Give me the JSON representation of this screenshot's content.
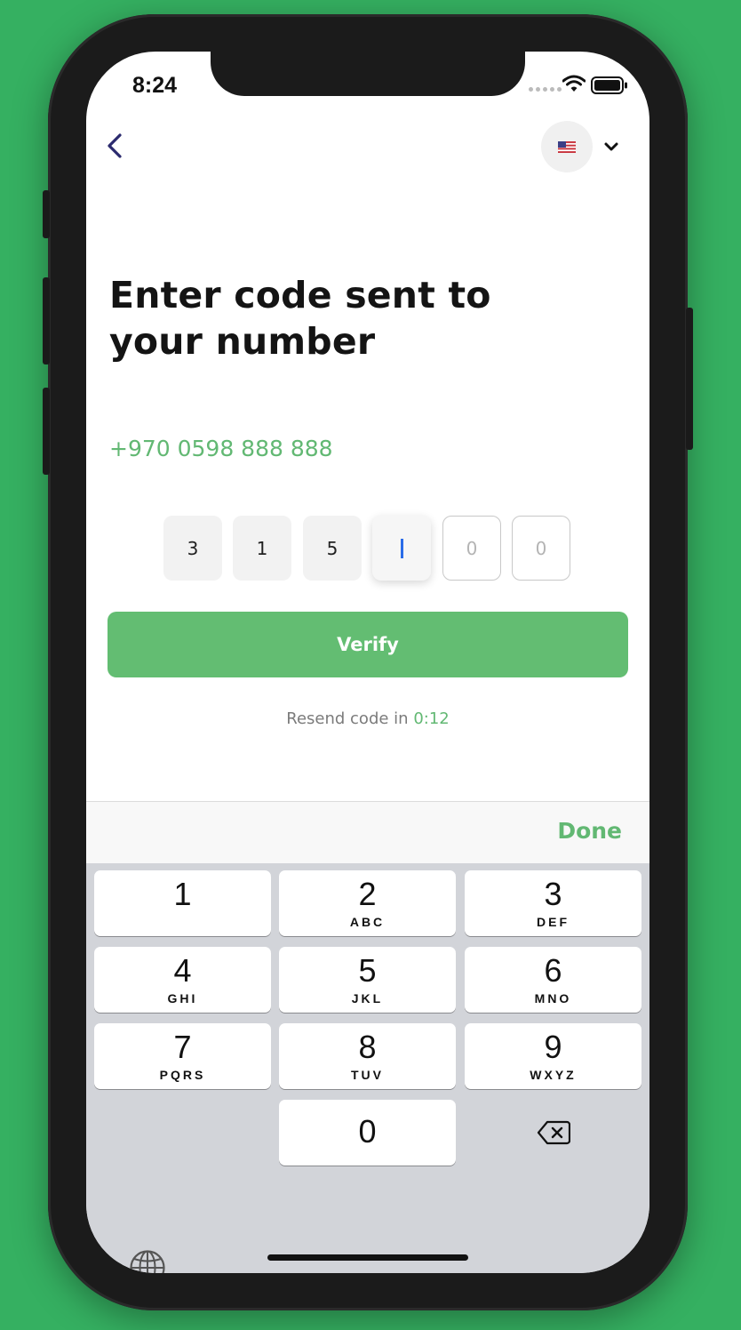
{
  "status_bar": {
    "time": "8:24"
  },
  "header": {
    "country": "US",
    "flag_icon": "us-flag-icon"
  },
  "title": "Enter code sent to your number",
  "phone_number": "+970 0598 888 888",
  "code": {
    "digits": [
      "3",
      "1",
      "5",
      "",
      "0",
      "0"
    ],
    "active_index": 3
  },
  "verify_label": "Verify",
  "resend": {
    "text": "Resend code in",
    "timer": "0:12"
  },
  "keyboard": {
    "done_label": "Done",
    "keys": [
      {
        "digit": "1",
        "letters": ""
      },
      {
        "digit": "2",
        "letters": "ABC"
      },
      {
        "digit": "3",
        "letters": "DEF"
      },
      {
        "digit": "4",
        "letters": "GHI"
      },
      {
        "digit": "5",
        "letters": "JKL"
      },
      {
        "digit": "6",
        "letters": "MNO"
      },
      {
        "digit": "7",
        "letters": "PQRS"
      },
      {
        "digit": "8",
        "letters": "TUV"
      },
      {
        "digit": "9",
        "letters": "WXYZ"
      },
      {
        "digit": "0",
        "letters": ""
      }
    ]
  },
  "colors": {
    "background": "#35b061",
    "accent_green": "#62b873",
    "button_green": "#63bd72",
    "caret_blue": "#2a6ce8"
  }
}
